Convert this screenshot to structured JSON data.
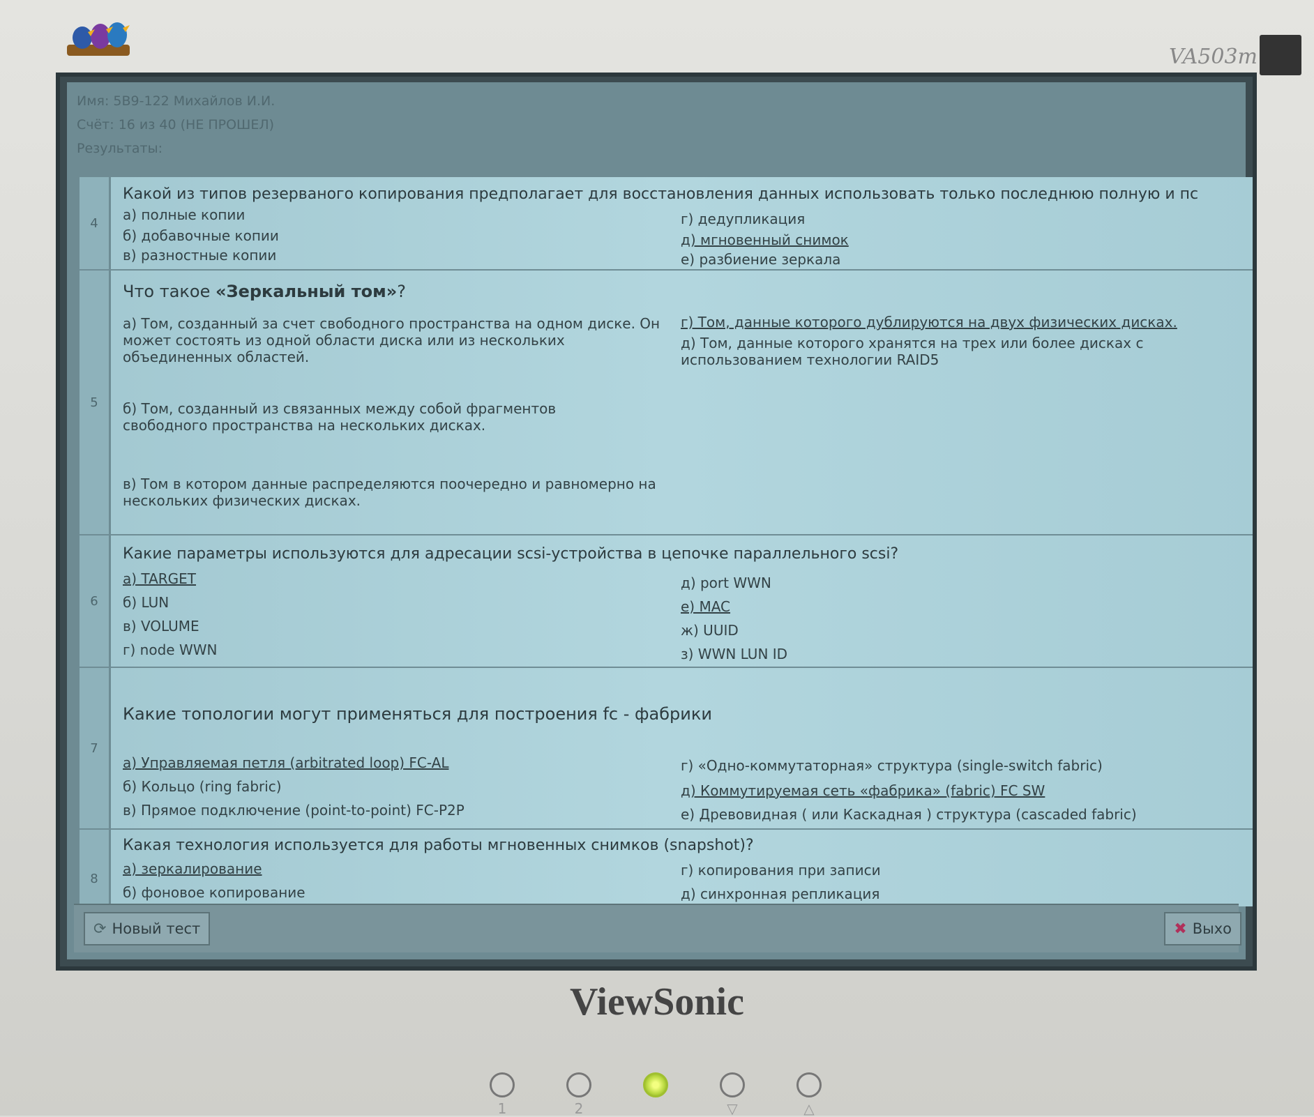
{
  "monitor": {
    "brand": "ViewSonic",
    "model": "VA503m",
    "buttons": [
      "1",
      "2",
      "",
      "▽",
      "△"
    ]
  },
  "header": {
    "line1": "Имя: 5B9-122 Михайлов И.И.",
    "line2": "Счёт: 16 из 40 (НЕ ПРОШЕЛ)",
    "line3": "Результаты:"
  },
  "questions": [
    {
      "num": "4",
      "text": "Какой из типов резерваного копирования предполагает для восстановления данных использовать только последнюю полную и пс",
      "left": [
        "а) полные копии",
        "б) добавочные  копии",
        "в) разностные  копии"
      ],
      "right": [
        "г) дедупликация",
        "д) мгновенный снимок",
        "е) разбиение зеркала"
      ]
    },
    {
      "num": "5",
      "text_pre": "Что такое ",
      "text_bold": "«Зеркальный том»",
      "text_post": "?",
      "left": [
        "а) Том, созданный за счет свободного пространства на одном диске. Он может состоять из одной области диска или из нескольких объединенных областей.",
        "б) Том, созданный  из связанных между собой фрагментов свободного пространства на нескольких дисках.",
        "в) Том в котором данные распределяются поочередно и равномерно на нескольких физических дисках."
      ],
      "right": [
        "г) Том, данные которого дублируются на двух физических дисках.",
        "д) Том, данные которого хранятся на трех или более дисках с использованием технологии RAID5"
      ]
    },
    {
      "num": "6",
      "text": "Какие параметры используются для адресации scsi-устройства в цепочке параллельного scsi?",
      "left": [
        "а) TARGET",
        "б) LUN",
        "в) VOLUME",
        "г) node WWN"
      ],
      "right": [
        "д) port WWN",
        "е) MAC",
        "ж) UUID",
        "з) WWN LUN ID"
      ]
    },
    {
      "num": "7",
      "text": "Какие топологии могут применяться для построения fc - фабрики",
      "left": [
        "а) Управляемая петля (arbitrated loop) FC-AL",
        "б) Кольцо (ring fabric)",
        "в) Прямое подключение (point-to-point) FC-P2P"
      ],
      "right": [
        "г) «Одно-коммутаторная» структура (single-switch fabric)",
        "д) Коммутируемая сеть  «фабрика» (fabric) FC  SW",
        "е) Древовидная ( или Каскадная ) структура (cascaded fabric)"
      ]
    },
    {
      "num": "8",
      "text": "Какая технология используется для работы мгновенных снимков (snapshot)?",
      "left": [
        "а) зеркалирование",
        "б) фоновое копирование"
      ],
      "right": [
        "г) копирования при записи",
        "д) синхронная репликация"
      ]
    }
  ],
  "footer": {
    "new_test": "Новый тест",
    "exit": "Выхо"
  }
}
